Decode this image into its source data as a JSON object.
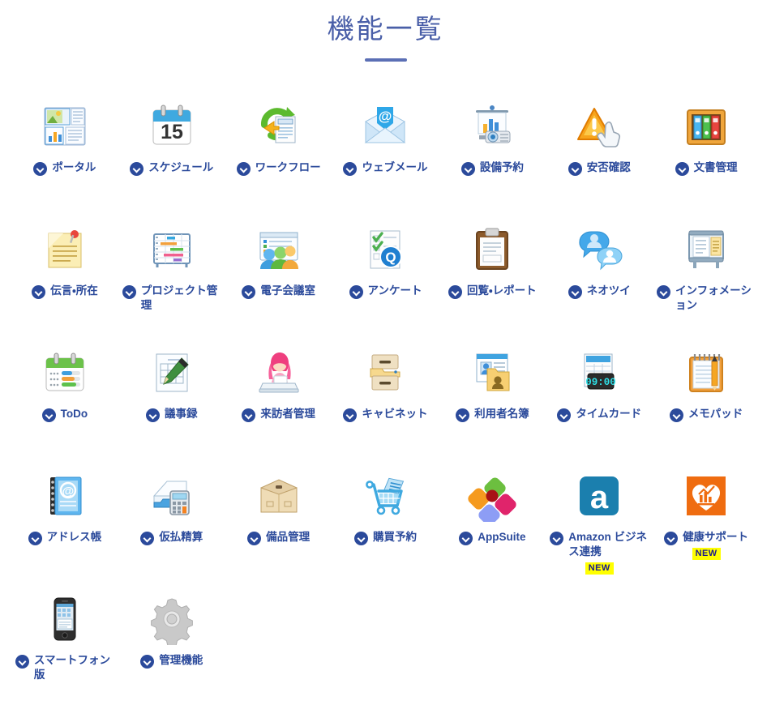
{
  "header": {
    "title": "機能一覧",
    "title_color": "#4a5fa8",
    "rule_color": "#5b6fb5"
  },
  "theme": {
    "label_color": "#2b4a9b",
    "badge_color": "#2b4a9b",
    "new_badge_bg": "#ffff00",
    "background": "#ffffff"
  },
  "new_badge_label": "NEW",
  "features": [
    {
      "label": "ポータル",
      "icon": "portal-icon"
    },
    {
      "label": "スケジュール",
      "icon": "calendar-icon"
    },
    {
      "label": "ワークフロー",
      "icon": "workflow-icon"
    },
    {
      "label": "ウェブメール",
      "icon": "webmail-icon"
    },
    {
      "label": "設備予約",
      "icon": "equipment-reservation-icon"
    },
    {
      "label": "安否確認",
      "icon": "safety-confirmation-icon"
    },
    {
      "label": "文書管理",
      "icon": "document-management-icon"
    },
    {
      "label": "伝言・所在",
      "icon": "message-note-icon"
    },
    {
      "label": "プロジェクト管理",
      "icon": "project-gantt-icon"
    },
    {
      "label": "電子会議室",
      "icon": "conference-room-icon"
    },
    {
      "label": "アンケート",
      "icon": "survey-icon"
    },
    {
      "label": "回覧・レポート",
      "icon": "clipboard-report-icon"
    },
    {
      "label": "ネオツイ",
      "icon": "speech-bubbles-icon"
    },
    {
      "label": "インフォメーション",
      "icon": "bulletin-board-icon"
    },
    {
      "label": "ToDo",
      "icon": "todo-icon"
    },
    {
      "label": "議事録",
      "icon": "minutes-icon"
    },
    {
      "label": "来訪者管理",
      "icon": "visitor-reception-icon"
    },
    {
      "label": "キャビネット",
      "icon": "cabinet-icon"
    },
    {
      "label": "利用者名簿",
      "icon": "user-directory-icon"
    },
    {
      "label": "タイムカード",
      "icon": "timecard-icon",
      "icon_text": "09:00"
    },
    {
      "label": "メモパッド",
      "icon": "memopad-icon"
    },
    {
      "label": "アドレス帳",
      "icon": "address-book-icon"
    },
    {
      "label": "仮払精算",
      "icon": "expense-calculator-icon"
    },
    {
      "label": "備品管理",
      "icon": "supplies-box-icon"
    },
    {
      "label": "購買予約",
      "icon": "shopping-cart-icon"
    },
    {
      "label": "AppSuite",
      "icon": "appsuite-icon"
    },
    {
      "label": "Amazon ビジネス連携",
      "icon": "amazon-business-icon",
      "icon_text": "a",
      "new": true
    },
    {
      "label": "健康サポート",
      "icon": "health-support-icon",
      "new": true
    },
    {
      "label": "スマートフォン版",
      "icon": "smartphone-icon"
    },
    {
      "label": "管理機能",
      "icon": "gear-admin-icon"
    }
  ]
}
